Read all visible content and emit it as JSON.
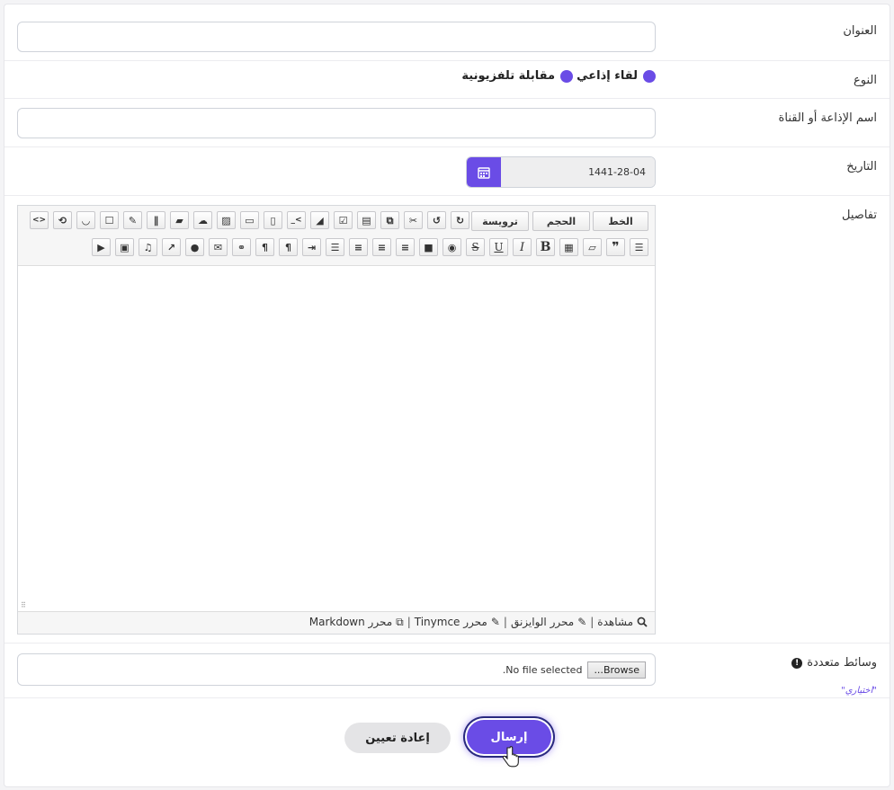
{
  "form": {
    "title_label": "العنوان",
    "title_value": "",
    "type_label": "النوع",
    "type_options": [
      "لقاء إذاعي",
      "مقابلة تلفزيونية"
    ],
    "station_label": "اسم الإذاعة أو القناة",
    "station_value": "",
    "date_label": "التاريخ",
    "date_value": "1441-28-04",
    "details_label": "تفاصيل",
    "media_label": "وسائط متعددة",
    "media_optional": "\"اختياري\"",
    "file_status": "No file selected.",
    "browse_label": "Browse..."
  },
  "editor": {
    "dropdowns": {
      "font": "الخط",
      "size": "الحجم",
      "heading": "ترويسة"
    },
    "footer": {
      "preview": "مشاهدة",
      "wysiwyg": "محرر الوايزنق",
      "tinymce": "محرر Tinymce",
      "markdown": "محرر Markdown",
      "sep": "|"
    }
  },
  "actions": {
    "submit_label": "إرسال",
    "reset_label": "إعادة تعيين"
  },
  "colors": {
    "accent": "#6a4ce6"
  }
}
